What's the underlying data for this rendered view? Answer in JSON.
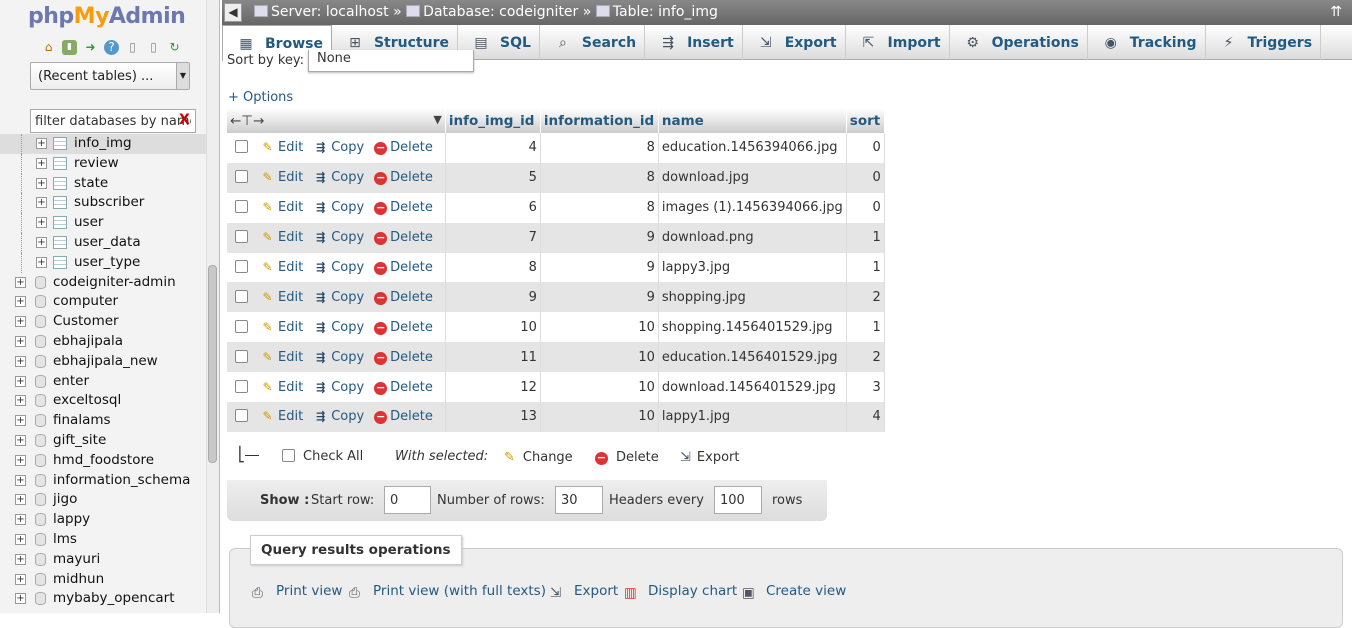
{
  "nav": {
    "logo": {
      "php": "php",
      "my": "My",
      "admin": "Admin"
    },
    "recent_tables": "(Recent tables) ...",
    "filter_placeholder": "filter databases by name",
    "tables": [
      "info_img",
      "review",
      "state",
      "subscriber",
      "user",
      "user_data",
      "user_type"
    ],
    "databases": [
      "codeigniter-admin",
      "computer",
      "Customer",
      "ebhajipala",
      "ebhajipala_new",
      "enter",
      "exceltosql",
      "finalams",
      "gift_site",
      "hmd_foodstore",
      "information_schema",
      "jigo",
      "lappy",
      "lms",
      "mayuri",
      "midhun",
      "mybaby_opencart"
    ]
  },
  "breadcrumb": {
    "server": "Server: localhost",
    "database": "Database: codeigniter",
    "table": "Table: info_img",
    "sep": "»"
  },
  "tabs": [
    "Browse",
    "Structure",
    "SQL",
    "Search",
    "Insert",
    "Export",
    "Import",
    "Operations",
    "Tracking",
    "Triggers"
  ],
  "sort": {
    "label": "Sort by key:",
    "value": "None"
  },
  "options_link": "+ Options",
  "grid": {
    "columns": [
      "info_img_id",
      "information_id",
      "name",
      "sort"
    ],
    "actions": {
      "edit": "Edit",
      "copy": "Copy",
      "delete": "Delete"
    },
    "rows": [
      {
        "info_img_id": "4",
        "information_id": "8",
        "name": "education.1456394066.jpg",
        "sort": "0"
      },
      {
        "info_img_id": "5",
        "information_id": "8",
        "name": "download.jpg",
        "sort": "0"
      },
      {
        "info_img_id": "6",
        "information_id": "8",
        "name": "images (1).1456394066.jpg",
        "sort": "0"
      },
      {
        "info_img_id": "7",
        "information_id": "9",
        "name": "download.png",
        "sort": "1"
      },
      {
        "info_img_id": "8",
        "information_id": "9",
        "name": "lappy3.jpg",
        "sort": "1"
      },
      {
        "info_img_id": "9",
        "information_id": "9",
        "name": "shopping.jpg",
        "sort": "2"
      },
      {
        "info_img_id": "10",
        "information_id": "10",
        "name": "shopping.1456401529.jpg",
        "sort": "1"
      },
      {
        "info_img_id": "11",
        "information_id": "10",
        "name": "education.1456401529.jpg",
        "sort": "2"
      },
      {
        "info_img_id": "12",
        "information_id": "10",
        "name": "download.1456401529.jpg",
        "sort": "3"
      },
      {
        "info_img_id": "13",
        "information_id": "10",
        "name": "lappy1.jpg",
        "sort": "4"
      }
    ]
  },
  "bulk": {
    "check_all": "Check All",
    "with_selected": "With selected:",
    "change": "Change",
    "delete": "Delete",
    "export": "Export"
  },
  "show": {
    "label": "Show :",
    "start_row_label": "Start row:",
    "start_row": "0",
    "num_rows_label": "Number of rows:",
    "num_rows": "30",
    "headers_label": "Headers every",
    "headers": "100",
    "rows_label": "rows"
  },
  "query_ops": {
    "title": "Query results operations",
    "links": [
      "Print view",
      "Print view (with full texts)",
      "Export",
      "Display chart",
      "Create view"
    ]
  }
}
